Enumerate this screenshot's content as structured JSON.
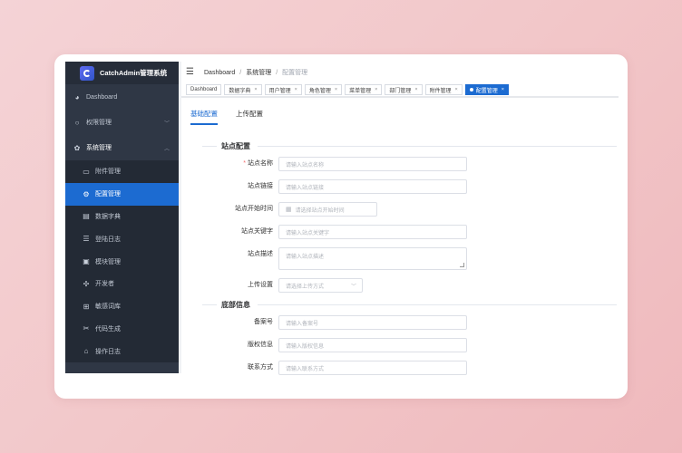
{
  "app": {
    "title": "CatchAdmin管理系统"
  },
  "sidebar": {
    "items": [
      {
        "label": "Dashboard",
        "icon": "dashboard-icon"
      },
      {
        "label": "权限管理",
        "icon": "circle-icon"
      },
      {
        "label": "系统管理",
        "icon": "gear-icon"
      }
    ],
    "sub_items": [
      {
        "label": "附件管理",
        "icon": "folder-icon"
      },
      {
        "label": "配置管理",
        "icon": "gear-icon"
      },
      {
        "label": "数据字典",
        "icon": "database-icon"
      },
      {
        "label": "登陆日志",
        "icon": "database-icon"
      },
      {
        "label": "模块管理",
        "icon": "module-icon"
      },
      {
        "label": "开发者",
        "icon": "crosshair-icon"
      },
      {
        "label": "敏感词库",
        "icon": "folder-plus-icon"
      },
      {
        "label": "代码生成",
        "icon": "scissors-icon"
      },
      {
        "label": "操作日志",
        "icon": "home-icon"
      }
    ],
    "active_sub_item": "配置管理"
  },
  "breadcrumb": [
    "Dashboard",
    "系统管理",
    "配置管理"
  ],
  "tabs": [
    {
      "label": "Dashboard",
      "closable": false
    },
    {
      "label": "数据字典",
      "closable": true
    },
    {
      "label": "用户管理",
      "closable": true
    },
    {
      "label": "角色管理",
      "closable": true
    },
    {
      "label": "菜单管理",
      "closable": true
    },
    {
      "label": "部门管理",
      "closable": true
    },
    {
      "label": "附件管理",
      "closable": true
    },
    {
      "label": "配置管理",
      "closable": true,
      "active": true
    }
  ],
  "tab_close_glyph": "×",
  "subtabs": [
    {
      "label": "基础配置",
      "active": true
    },
    {
      "label": "上传配置"
    }
  ],
  "sections": {
    "site": "站点配置",
    "footer": "底部信息"
  },
  "form": {
    "site_name": {
      "label": "站点名称",
      "placeholder": "请输入站点名称",
      "required": true,
      "required_mark": "*"
    },
    "site_url": {
      "label": "站点链接",
      "placeholder": "请输入站点链接"
    },
    "start_time": {
      "label": "站点开始时间",
      "placeholder": "请选择站点开始时间"
    },
    "keywords": {
      "label": "站点关键字",
      "placeholder": "请输入站点关键字"
    },
    "description": {
      "label": "站点描述",
      "placeholder": "请输入站点描述"
    },
    "upload": {
      "label": "上传设置",
      "placeholder": "请选择上传方式"
    },
    "icp": {
      "label": "备案号",
      "placeholder": "请输入备案号"
    },
    "copyright": {
      "label": "版权信息",
      "placeholder": "请输入版权信息"
    },
    "contact": {
      "label": "联系方式",
      "placeholder": "请输入联系方式"
    }
  },
  "colors": {
    "primary": "#1c6bd1",
    "sidebar_bg": "#2f3745",
    "required": "#f56c6c"
  }
}
